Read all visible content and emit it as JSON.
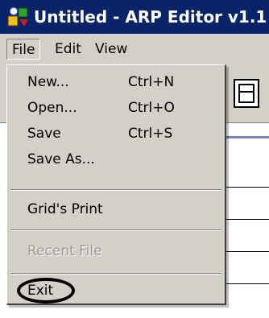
{
  "window": {
    "title": "Untitled - ARP Editor v1.1",
    "icon": "app-icon"
  },
  "menubar": {
    "items": [
      "File",
      "Edit",
      "View"
    ]
  },
  "file_menu": {
    "items": [
      {
        "label": "New...",
        "shortcut": "Ctrl+N",
        "enabled": true
      },
      {
        "label": "Open...",
        "shortcut": "Ctrl+O",
        "enabled": true
      },
      {
        "label": "Save",
        "shortcut": "Ctrl+S",
        "enabled": true
      },
      {
        "label": "Save As...",
        "shortcut": "",
        "enabled": true
      },
      {
        "label": "Grid's Print",
        "shortcut": "",
        "enabled": true
      },
      {
        "label": "Recent File",
        "shortcut": "",
        "enabled": false
      },
      {
        "label": "Exit",
        "shortcut": "",
        "enabled": true,
        "highlighted": true
      }
    ]
  },
  "colors": {
    "titlebar": "#0a246a",
    "menu_face": "#d4d0c8",
    "disabled_text": "#9c9a94"
  }
}
